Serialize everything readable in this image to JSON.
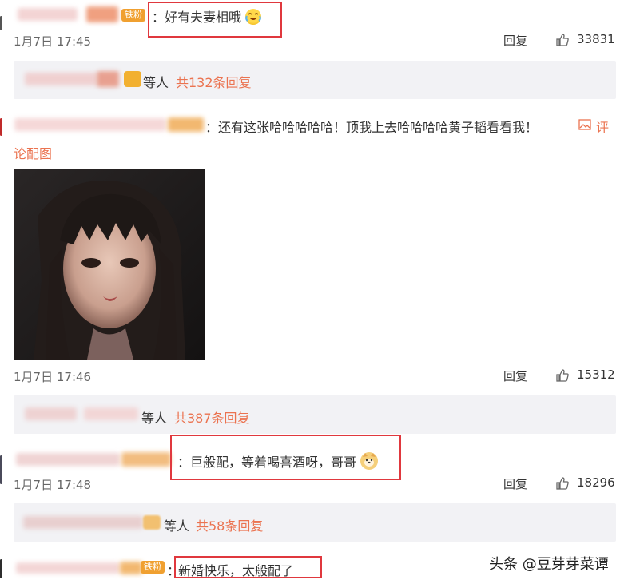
{
  "comments": [
    {
      "badge": "铁粉",
      "text": "：好有夫妻相哦",
      "time": "1月7日 17:45",
      "reply_label": "回复",
      "likes": "33831",
      "sub_etc": "等人",
      "sub_link": "共132条回复"
    },
    {
      "text": "：还有这张哈哈哈哈哈！顶我上去哈哈哈哈黄子韬看看我！",
      "pic_label_1": "评",
      "pic_label_2": "论配图",
      "time": "1月7日 17:46",
      "reply_label": "回复",
      "likes": "15312",
      "sub_etc": "等人",
      "sub_link": "共387条回复"
    },
    {
      "text": "：巨般配，等着喝喜酒呀，哥哥",
      "time": "1月7日 17:48",
      "reply_label": "回复",
      "likes": "18296",
      "sub_etc": "等人",
      "sub_link": "共58条回复"
    },
    {
      "badge": "铁粉",
      "text_prefix": "：",
      "text": "新婚快乐，太般配了"
    }
  ],
  "watermark": "头条 @豆芽芽菜谭",
  "colors": {
    "link": "#eb7350",
    "highlight_box": "#e0383e",
    "sub_bg": "#f2f2f5",
    "badge": "#f0a030"
  },
  "icons": [
    "like-icon",
    "image-icon",
    "emoji-laugh-cry",
    "emoji-doge"
  ]
}
